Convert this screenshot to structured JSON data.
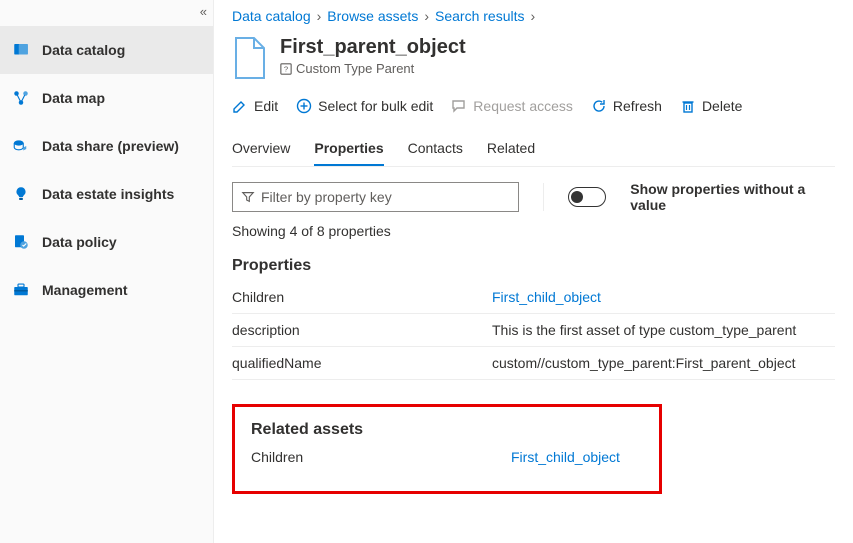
{
  "sidebar": {
    "items": [
      {
        "label": "Data catalog"
      },
      {
        "label": "Data map"
      },
      {
        "label": "Data share (preview)"
      },
      {
        "label": "Data estate insights"
      },
      {
        "label": "Data policy"
      },
      {
        "label": "Management"
      }
    ]
  },
  "breadcrumb": [
    "Data catalog",
    "Browse assets",
    "Search results"
  ],
  "asset": {
    "title": "First_parent_object",
    "type": "Custom Type Parent"
  },
  "toolbar": {
    "edit": "Edit",
    "bulk": "Select for bulk edit",
    "request": "Request access",
    "refresh": "Refresh",
    "delete": "Delete"
  },
  "tabs": [
    "Overview",
    "Properties",
    "Contacts",
    "Related"
  ],
  "filter": {
    "placeholder": "Filter by property key"
  },
  "toggle_label": "Show properties without a value",
  "showing": "Showing 4 of 8 properties",
  "properties": {
    "title": "Properties",
    "rows": [
      {
        "key": "Children",
        "value": "First_child_object",
        "link": true
      },
      {
        "key": "description",
        "value": "This is the first asset of type custom_type_parent",
        "link": false
      },
      {
        "key": "qualifiedName",
        "value": "custom//custom_type_parent:First_parent_object",
        "link": false
      }
    ]
  },
  "related": {
    "title": "Related assets",
    "rows": [
      {
        "key": "Children",
        "value": "First_child_object",
        "link": true
      }
    ]
  }
}
